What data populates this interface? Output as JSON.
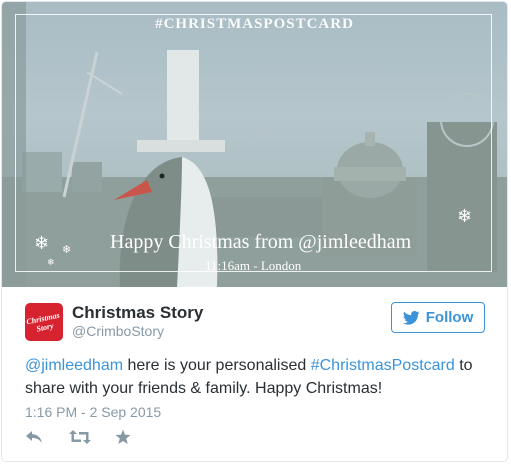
{
  "postcard": {
    "hashtag_title": "#CHRISTMASPOSTCARD",
    "greeting": "Happy Christmas from @jimleedham",
    "time_place": "11:16am - London"
  },
  "tweet": {
    "display_name": "Christmas Story",
    "handle": "@CrimboStory",
    "avatar_text": "Christmas Story",
    "follow_label": "Follow",
    "text_mention": "@jimleedham",
    "text_part1": " here is your personalised ",
    "text_hashtag": "#ChristmasPostcard",
    "text_part2": " to share with your friends & family. Happy Christmas!",
    "timestamp": "1:16 PM - 2 Sep 2015"
  },
  "actions": {
    "reply_icon": "reply-icon",
    "retweet_icon": "retweet-icon",
    "favorite_icon": "star-icon"
  },
  "colors": {
    "link": "#3b94d9",
    "text": "#292f33",
    "muted": "#8899a6",
    "avatar_bg": "#d7232f"
  }
}
